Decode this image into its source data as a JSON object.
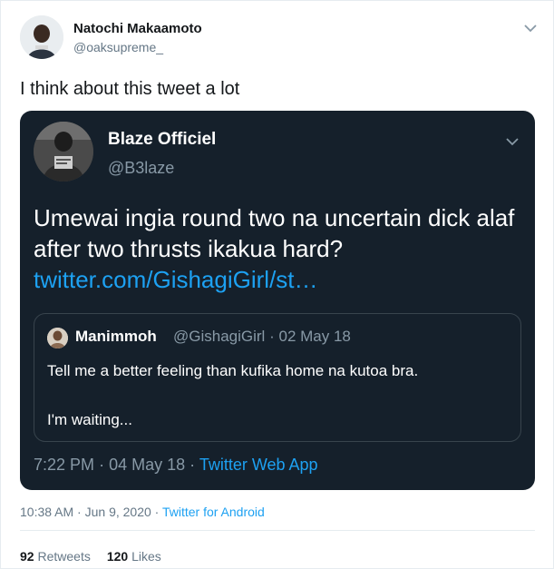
{
  "outer_tweet": {
    "name": "Natochi Makaamoto",
    "handle": "@oaksupreme_",
    "text": "I think about this tweet a lot",
    "time": "10:38 AM",
    "date": "Jun 9, 2020",
    "separator": "·",
    "app": "Twitter for Android",
    "retweets_count": "92",
    "retweets_label": "Retweets",
    "likes_count": "120",
    "likes_label": "Likes"
  },
  "embedded_tweet": {
    "name": "Blaze Officiel",
    "handle": "@B3laze",
    "text": "Umewai ingia round two na uncertain dick alaf after two thrusts ikakua hard?",
    "link": "twitter.com/GishagiGirl/st…",
    "time": "7:22 PM",
    "date": "04 May 18",
    "separator": "·",
    "app": "Twitter Web App"
  },
  "quoted_tweet": {
    "name": "Manimmoh",
    "handle": "@GishagiGirl",
    "separator": "·",
    "date": "02 May 18",
    "line1": "Tell me a better feeling than kufika home na kutoa bra.",
    "line2": "I'm waiting..."
  },
  "icons": {
    "outer_menu": "chevron-down-icon",
    "embed_menu": "chevron-down-icon"
  },
  "colors": {
    "link_blue": "#1da1f2",
    "dark_card": "#15202b",
    "muted_gray": "#657786"
  }
}
